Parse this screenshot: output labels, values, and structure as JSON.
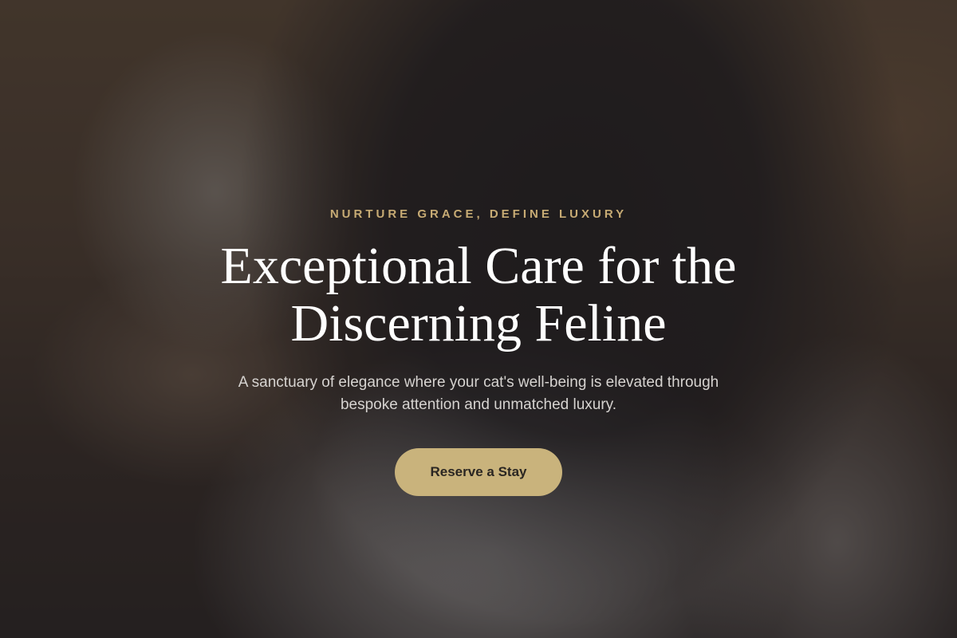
{
  "hero": {
    "eyebrow": "NURTURE GRACE, DEFINE LUXURY",
    "headline": "Exceptional Care for the Discerning Feline",
    "subtext": "A sanctuary of elegance where your cat's well-being is elevated through bespoke attention and unmatched luxury.",
    "cta_label": "Reserve a Stay"
  },
  "colors": {
    "accent": "#c9b37c",
    "eyebrow": "#c7ab74",
    "headline": "#ffffff",
    "subtext": "#d6d3d0",
    "overlay": "#1e1c20"
  }
}
